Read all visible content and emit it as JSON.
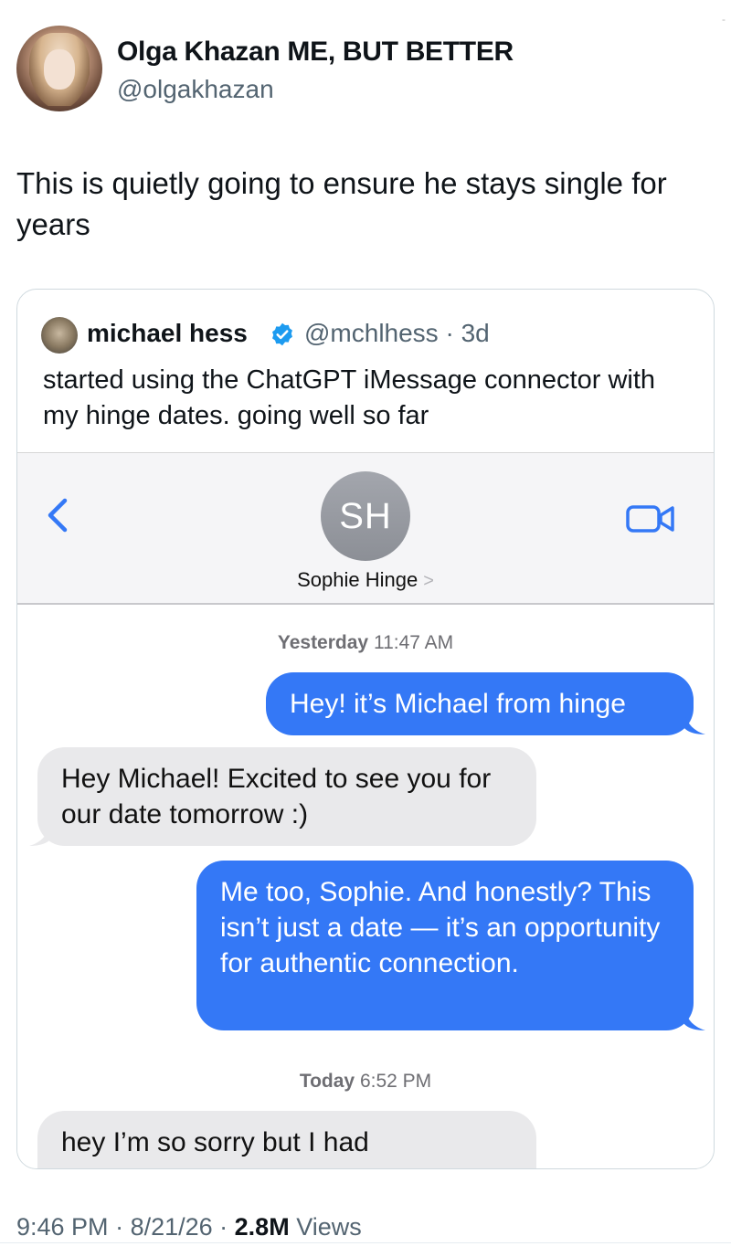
{
  "post": {
    "author_name": "Olga Khazan ME, BUT BETTER",
    "author_handle": "@olgakhazan",
    "text": "This is quietly going to ensure he stays single for years",
    "footer": {
      "time": "9:46 PM",
      "date": "8/21/26",
      "views_count": "2.8M",
      "views_label": "Views"
    }
  },
  "quoted_post": {
    "author_name": "michael hess",
    "author_handle": "@mchlhess",
    "age": "3d",
    "text": "started using the ChatGPT iMessage connector with my hinge dates. going well so far"
  },
  "imessage": {
    "contact_initials": "SH",
    "contact_name": "Sophie Hinge",
    "timestamps": [
      {
        "day": "Yesterday",
        "time": "11:47 AM"
      },
      {
        "day": "Today",
        "time": "6:52 PM"
      }
    ],
    "messages": [
      {
        "from": "me",
        "text": "Hey! it’s Michael from hinge"
      },
      {
        "from": "them",
        "text": "Hey Michael! Excited to see you for our date tomorrow :)"
      },
      {
        "from": "me",
        "text": "Me too, Sophie. And honestly? This isn’t just a date — it’s an opportunity for authentic connection."
      },
      {
        "from": "them",
        "text": "hey I’m so sorry but I had"
      }
    ]
  },
  "colors": {
    "imessage_blue": "#3478f6",
    "received_gray": "#e9e9eb",
    "secondary_text": "#536471",
    "verified_blue": "#1d9bf0"
  },
  "icons": [
    "back-chevron-icon",
    "video-camera-icon",
    "verified-badge-icon"
  ]
}
